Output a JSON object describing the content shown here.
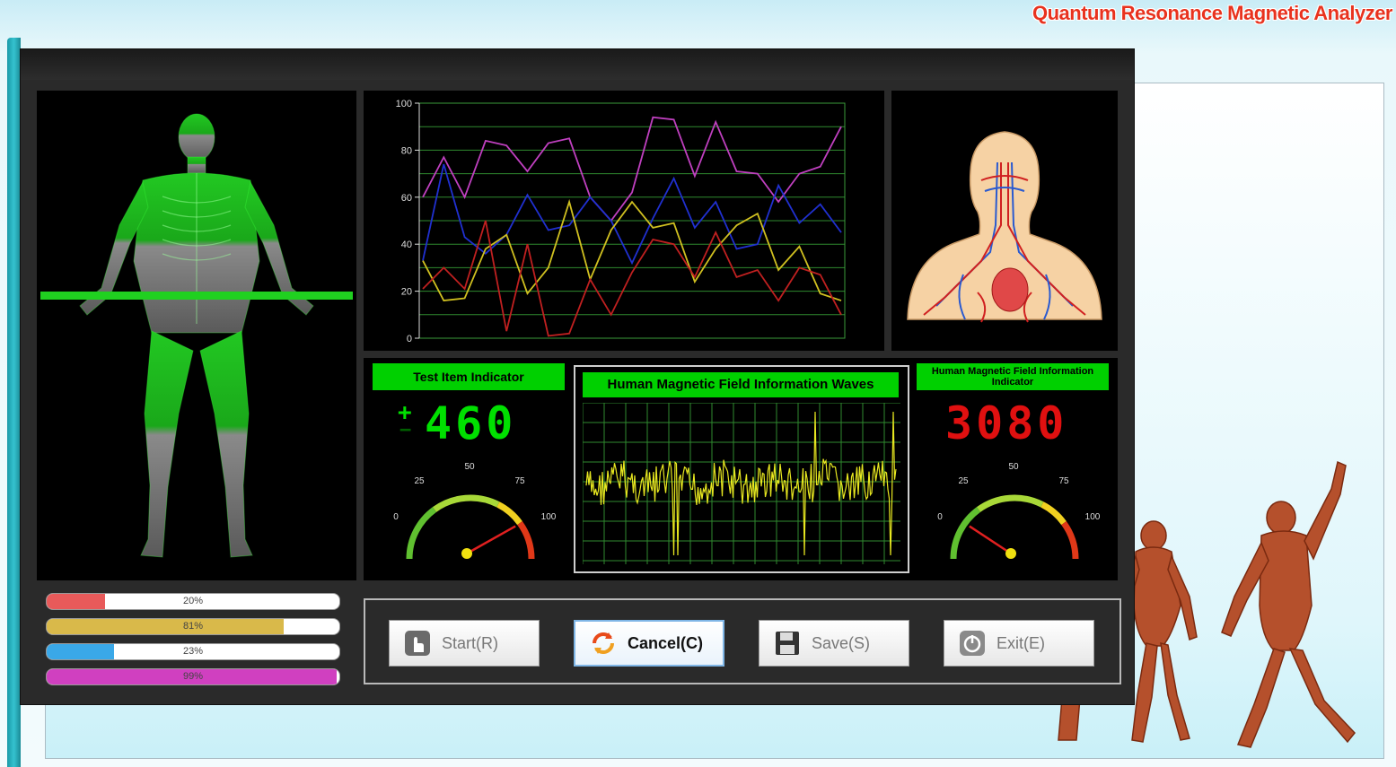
{
  "app": {
    "title": "Quantum Resonance Magnetic Analyzer"
  },
  "colors": {
    "accent_green": "#00d000",
    "title_red": "#e8321e",
    "digit_green": "#00e000",
    "digit_red": "#e01010"
  },
  "chart_data": {
    "type": "line",
    "ylim": [
      0,
      100
    ],
    "yticks": [
      "0",
      "20",
      "40",
      "60",
      "80",
      "100"
    ],
    "grid": true,
    "x": [
      1,
      2,
      3,
      4,
      5,
      6,
      7,
      8,
      9,
      10,
      11,
      12,
      13,
      14,
      15,
      16,
      17,
      18,
      19,
      20,
      21,
      22,
      23
    ],
    "series": [
      {
        "color": "#c040c0",
        "values": [
          60,
          77,
          60,
          84,
          82,
          71,
          83,
          85,
          60,
          50,
          62,
          94,
          93,
          69,
          92,
          71,
          70,
          58,
          70,
          73,
          90
        ]
      },
      {
        "color": "#2030d0",
        "values": [
          33,
          74,
          43,
          36,
          44,
          61,
          46,
          48,
          60,
          50,
          32,
          51,
          68,
          47,
          58,
          38,
          40,
          65,
          49,
          57,
          45
        ]
      },
      {
        "color": "#d0c020",
        "values": [
          33,
          16,
          17,
          38,
          44,
          19,
          30,
          58,
          25,
          46,
          58,
          47,
          49,
          24,
          38,
          48,
          53,
          29,
          39,
          19,
          16
        ]
      },
      {
        "color": "#c02020",
        "values": [
          21,
          30,
          21,
          50,
          3,
          40,
          1,
          2,
          25,
          10,
          28,
          42,
          40,
          26,
          45,
          26,
          29,
          16,
          30,
          27,
          10
        ]
      }
    ]
  },
  "test_indicator": {
    "label": "Test Item Indicator",
    "sign_plus": "+",
    "sign_minus": "−",
    "value": "460",
    "gauge_ticks": [
      "0",
      "25",
      "50",
      "75",
      "100"
    ],
    "gauge_value": 80
  },
  "waves": {
    "label": "Human Magnetic Field Information Waves"
  },
  "field_indicator": {
    "label": "Human Magnetic Field Information Indicator",
    "value": "3080",
    "gauge_ticks": [
      "0",
      "25",
      "50",
      "75",
      "100"
    ],
    "gauge_value": 20
  },
  "progress_bars": [
    {
      "text": "20%",
      "value": 20,
      "color": "#e85a5a"
    },
    {
      "text": "81%",
      "value": 81,
      "color": "#d9b94a"
    },
    {
      "text": "23%",
      "value": 23,
      "color": "#3aa8e8"
    },
    {
      "text": "99%",
      "value": 99,
      "color": "#d040c0"
    }
  ],
  "buttons": [
    {
      "label": "Start(R)",
      "icon": "hand-icon"
    },
    {
      "label": "Cancel(C)",
      "icon": "cancel-icon"
    },
    {
      "label": "Save(S)",
      "icon": "save-icon"
    },
    {
      "label": "Exit(E)",
      "icon": "power-icon"
    }
  ]
}
